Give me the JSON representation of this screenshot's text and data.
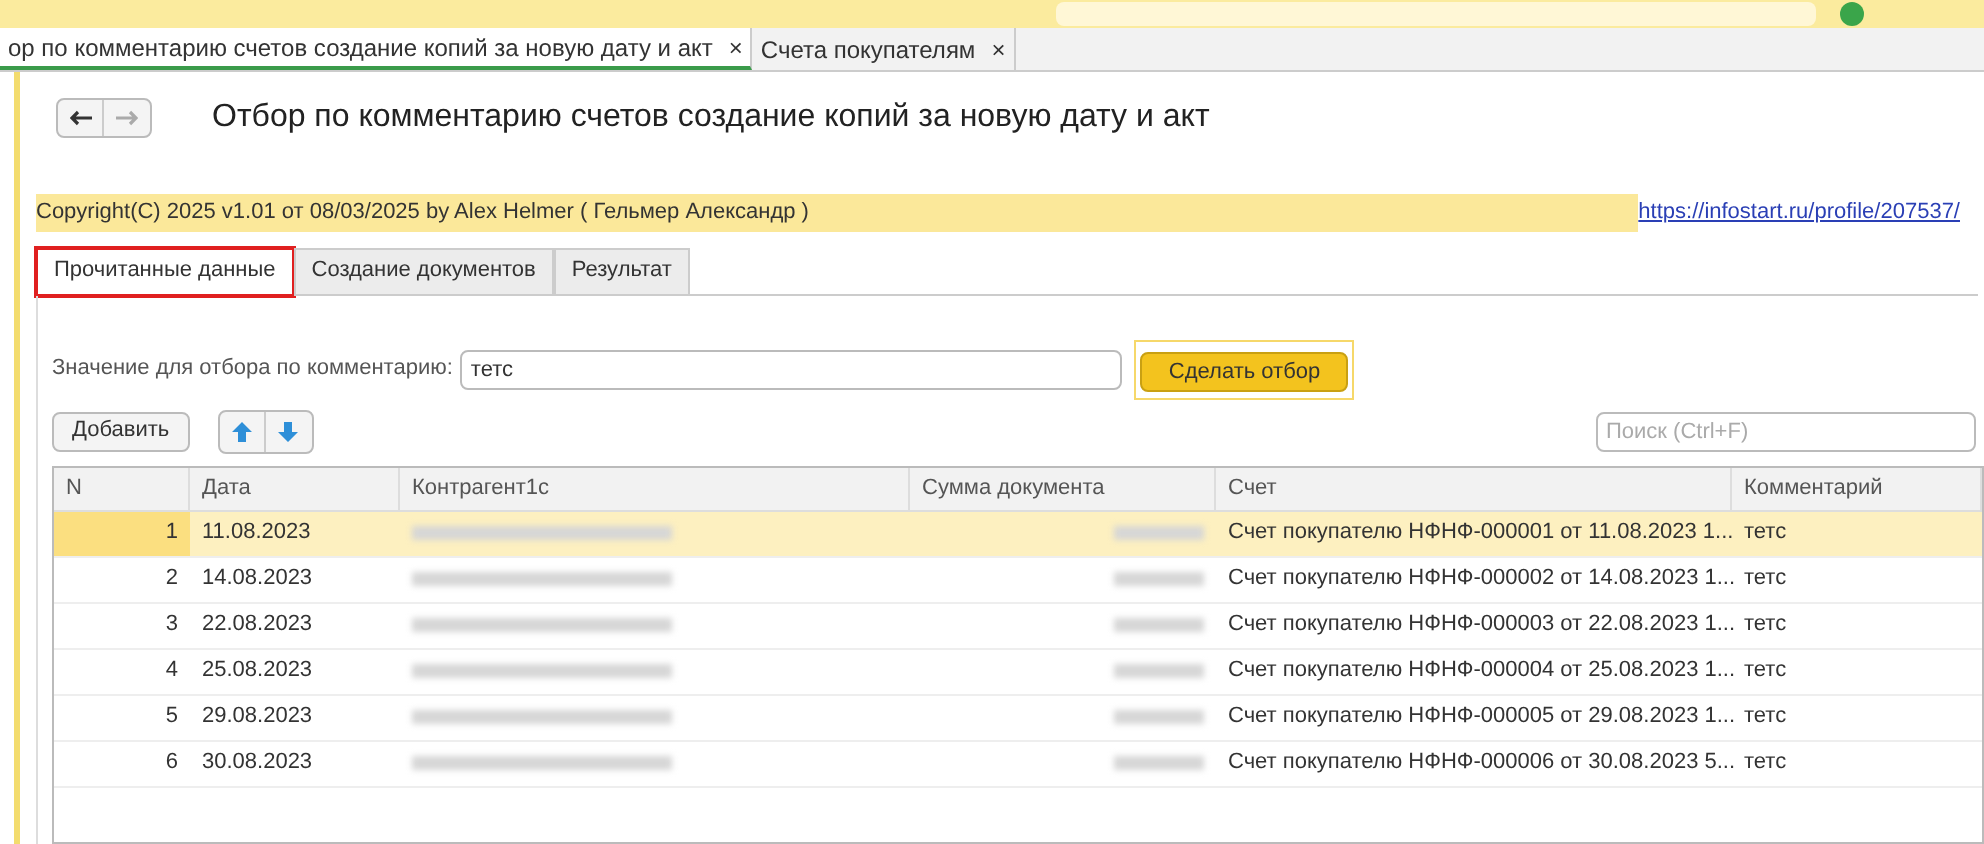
{
  "open_tabs": [
    {
      "label": "ор по комментарию счетов создание копий за новую дату и акт",
      "selected": true,
      "close": "×"
    },
    {
      "label": "Счета покупателям",
      "selected": false,
      "close": "×"
    }
  ],
  "form": {
    "title": "Отбор по комментарию счетов создание копий за новую дату и акт",
    "copyright": "Copyright(C)  2025 v1.01 от 08/03/2025  by Alex Helmer ( Гельмер Александр  )",
    "link": "https://infostart.ru/profile/207537/"
  },
  "tabs": [
    {
      "label": "Прочитанные данные",
      "selected": true
    },
    {
      "label": "Создание документов",
      "selected": false
    },
    {
      "label": "Результат",
      "selected": false
    }
  ],
  "filter": {
    "label": "Значение для отбора по комментарию:",
    "value": "тетс",
    "button": "Сделать отбор"
  },
  "toolbar": {
    "add_button": "Добавить",
    "search_placeholder": "Поиск (Ctrl+F)"
  },
  "table": {
    "columns": [
      "N",
      "Дата",
      "Контрагент1с",
      "Сумма документа",
      "Счет",
      "Комментарий"
    ],
    "rows": [
      {
        "n": "1",
        "date": "11.08.2023",
        "invoice": "Счет покупателю НФНФ-000001 от 11.08.2023 1...",
        "comment": "тетс",
        "selected": true
      },
      {
        "n": "2",
        "date": "14.08.2023",
        "invoice": "Счет покупателю НФНФ-000002 от 14.08.2023 1...",
        "comment": "тетс",
        "selected": false
      },
      {
        "n": "3",
        "date": "22.08.2023",
        "invoice": "Счет покупателю НФНФ-000003 от 22.08.2023 1...",
        "comment": "тетс",
        "selected": false
      },
      {
        "n": "4",
        "date": "25.08.2023",
        "invoice": "Счет покупателю НФНФ-000004 от 25.08.2023 1...",
        "comment": "тетс",
        "selected": false
      },
      {
        "n": "5",
        "date": "29.08.2023",
        "invoice": "Счет покупателю НФНФ-000005 от 29.08.2023 1...",
        "comment": "тетс",
        "selected": false
      },
      {
        "n": "6",
        "date": "30.08.2023",
        "invoice": "Счет покупателю НФНФ-000006 от 30.08.2023 5...",
        "comment": "тетс",
        "selected": false
      }
    ]
  }
}
